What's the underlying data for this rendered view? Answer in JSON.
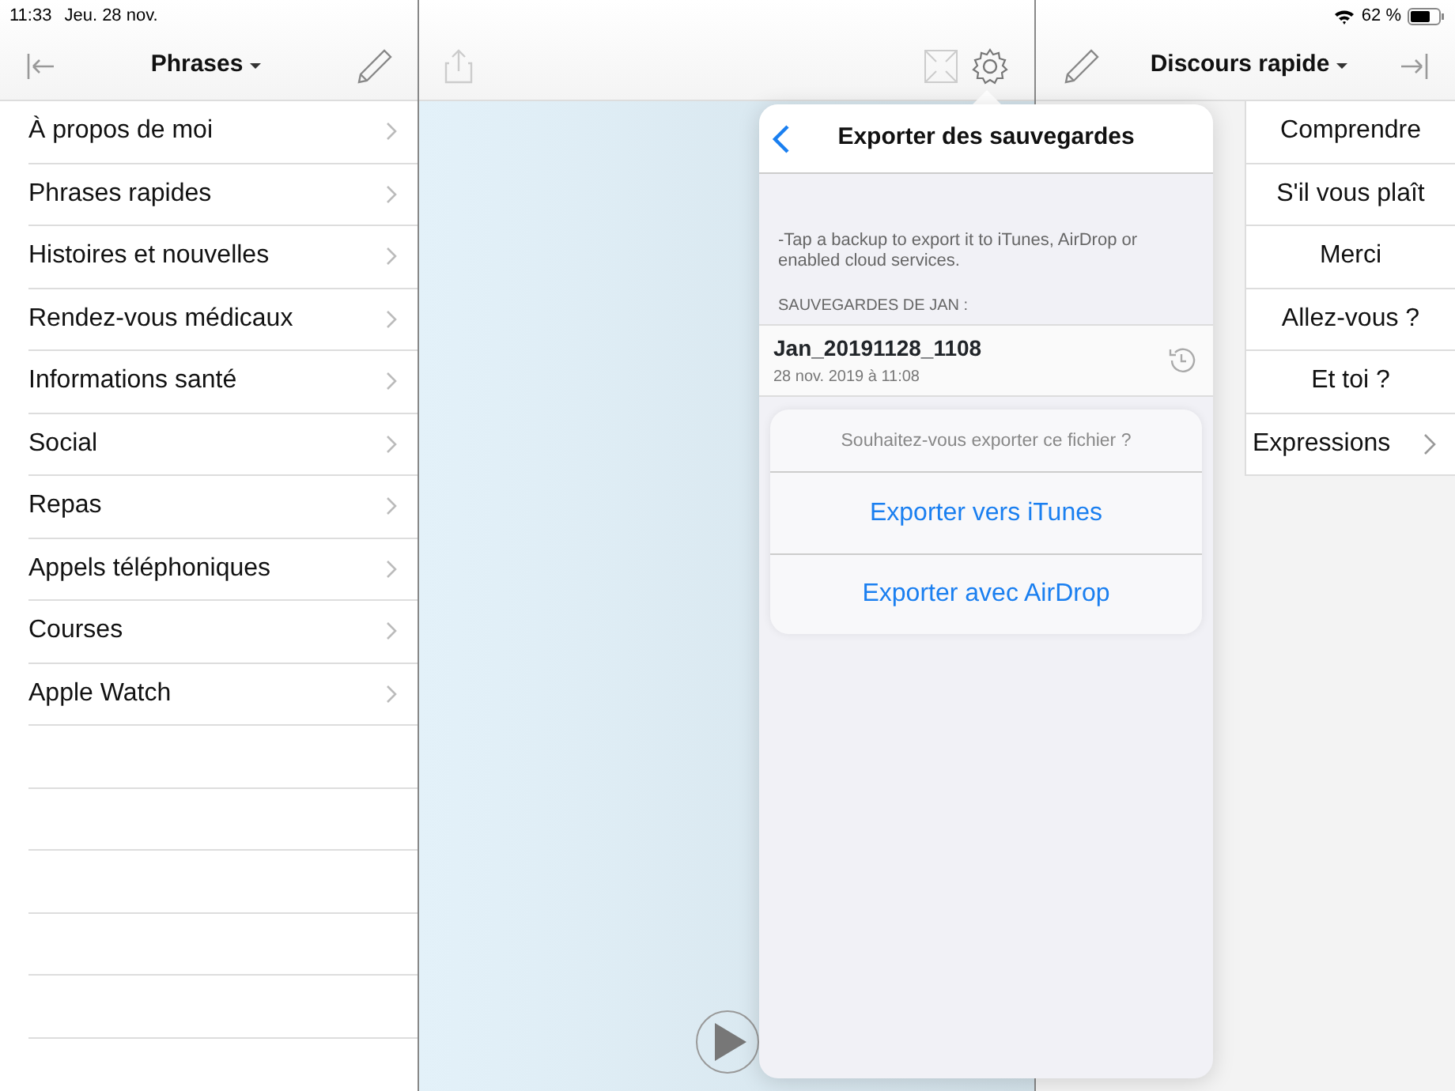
{
  "status_bar": {
    "time": "11:33",
    "date": "Jeu. 28 nov.",
    "battery": "62 %"
  },
  "left_panel": {
    "title": "Phrases",
    "items": [
      {
        "label": "À propos de moi"
      },
      {
        "label": "Phrases rapides"
      },
      {
        "label": "Histoires et nouvelles"
      },
      {
        "label": "Rendez-vous médicaux"
      },
      {
        "label": "Informations santé"
      },
      {
        "label": "Social"
      },
      {
        "label": "Repas"
      },
      {
        "label": "Appels téléphoniques"
      },
      {
        "label": "Courses"
      },
      {
        "label": "Apple Watch"
      }
    ]
  },
  "right_panel": {
    "title": "Discours rapide",
    "items": [
      {
        "label": "Comprendre",
        "kind": "phrase"
      },
      {
        "label": "S'il vous plaît",
        "kind": "phrase"
      },
      {
        "label": "Merci",
        "kind": "phrase"
      },
      {
        "label": "Allez-vous ?",
        "kind": "phrase"
      },
      {
        "label": "Et toi ?",
        "kind": "phrase"
      },
      {
        "label": "Expressions",
        "kind": "folder"
      }
    ]
  },
  "popover": {
    "title": "Exporter des sauvegardes",
    "note": "-Tap a backup to export it to iTunes, AirDrop or enabled cloud services.",
    "section_header": "SAUVEGARDES DE JAN :",
    "backups": [
      {
        "name": "Jan_20191128_1108",
        "date": "28 nov. 2019 à 11:08"
      }
    ],
    "action_sheet": {
      "title": "Souhaitez-vous exporter ce fichier ?",
      "actions": [
        "Exporter vers iTunes",
        "Exporter avec AirDrop"
      ]
    }
  }
}
